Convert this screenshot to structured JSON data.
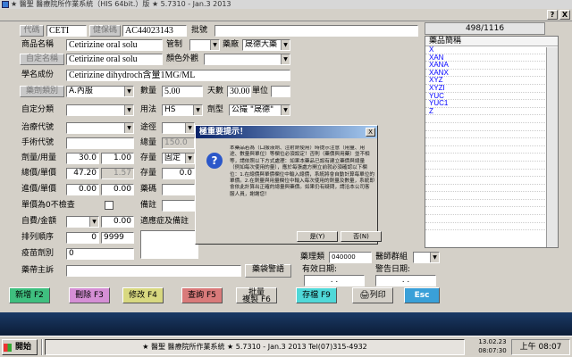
{
  "window": {
    "title": "★ 醫聖 醫療院所作業系統（HIS 64bit.）版 ★ 5.7310 - Jan.3 2013",
    "help_btn": "?",
    "close_btn": "X"
  },
  "form": {
    "btn_code": "代碼",
    "code_value": "CETI",
    "btn_health_code": "健保碼",
    "health_code_value": "AC44023143",
    "lbl_license": "批號",
    "license_value": "",
    "lbl_product_name": "商品名稱",
    "product_name_value": "Cetirizine oral solu",
    "lbl_control": "管制",
    "control_value": "",
    "lbl_vendor": "藥廠",
    "vendor_value": "晟德大藥",
    "btn_custom_name": "自定名稱",
    "custom_name_value": "Cetirizine oral solu",
    "lbl_color_shape": "顏色外觀",
    "color_shape_value": "",
    "lbl_ingredient": "學名成份",
    "ingredient_value": "Cetirizine dihydroch含量1MG/ML",
    "btn_drug_type": "藥劑類別",
    "drug_type_value": "A.內服",
    "lbl_qty": "數量",
    "qty_value": "5.00",
    "lbl_days": "天數",
    "days_value": "30.00",
    "lbl_unit": "單位",
    "unit_value": "",
    "lbl_custom_cat": "自定分類",
    "custom_cat_value": "",
    "lbl_usage": "用法",
    "usage_value": "HS",
    "lbl_form_type": "劑型",
    "form_type_value": "公撮 \"晟德\"",
    "lbl_treatment_code": "治療代號",
    "treatment_code_value": "",
    "lbl_route": "途徑",
    "route_value": "",
    "lbl_surgery_code": "手術代號",
    "surgery_code_value": "",
    "lbl_total_qty": "總量",
    "total_qty_value": "150.0",
    "lbl_dose": "劑量/用量",
    "dose_value1": "30.0",
    "dose_value2": "1.00",
    "lbl_total_price": "總價/單價",
    "total_price_value": "47.20",
    "unit_price_value": "1.57",
    "lbl_stock_type": "存量",
    "stock_type_value": "固定",
    "lbl_cost": "進價/單價",
    "cost_value1": "0.00",
    "cost_value2": "0.00",
    "lbl_inventory": "存量",
    "inventory_value": "0.0",
    "lbl_shelf": "藥碼",
    "shelf_value": "",
    "lbl_unit_zero": "單價為0不檢查",
    "lbl_remark": "備註",
    "remark_value": "",
    "lbl_copay": "自費/金額",
    "copay_value": "0.00",
    "lbl_sort": "排列順序",
    "sort_value": "0",
    "sort_value2": "9999",
    "lbl_special": "疫苗劑別",
    "special_value": "0",
    "lbl_indication": "適應症及備註",
    "indication_value": "",
    "lbl_warning": "藥帶主訴",
    "warning_value": "",
    "btn_warning": "藥袋警語",
    "lbl_drug_amount": "藥理類",
    "drug_amount_value": "040000",
    "lbl_med_group": "醫師群組",
    "lbl_start_date": "有效日期:",
    "start_date_value": ". .",
    "lbl_alert_date": "警告日期:",
    "alert_date_value": ". ."
  },
  "list": {
    "counter": "498/1116",
    "header": "藥品簡稱",
    "items": [
      "X",
      "XAN",
      "XANA",
      "XANX",
      "XYZ",
      "XYZI",
      "YUC",
      "YUC1",
      "Z",
      "",
      "",
      "",
      "",
      "",
      "",
      "",
      "",
      "",
      "",
      "",
      "",
      "",
      "",
      ""
    ]
  },
  "buttons": {
    "f2": "新增 F2",
    "f3": "刪除 F3",
    "f4": "修改 F4",
    "f5": "查詢 F5",
    "f6": "複製 F6",
    "f6_top": "批量",
    "f9": "存檔 F9",
    "print": "列印",
    "esc": "Esc"
  },
  "dialog": {
    "title": "極重要提示！",
    "close": "X",
    "text": "本藥品若為（口服液劑、注射劑使用）時提示注意（用量、用途、數量與單位）等欄位必須設定！否則（藥價與用藥）並不相等，請依照以下方式處理：如果本藥品已設有建立藥價與總量（例如每次使用的量），應於每張處方開立前就必須確認以下欄位：1.在總價與單價欄位中輸入總價，系統將會自動計算每單位的單價。2.在劑量與用量欄位中輸入每次使用的劑量及數量，系統即會依此計算出正確的總量與藥價。如果仍有疑問，請洽本公司客服人員，謝謝您！",
    "yes": "是(Y)",
    "no": "否(N)"
  },
  "taskbar": {
    "start": "開始",
    "app": "★ 醫聖 醫療院所作業系統 ★ 5.7310 - Jan.3 2013  Tel(07)315-4932",
    "date": "13.02.23",
    "time_small": "08:07:30",
    "clock": "上午 08:07"
  }
}
